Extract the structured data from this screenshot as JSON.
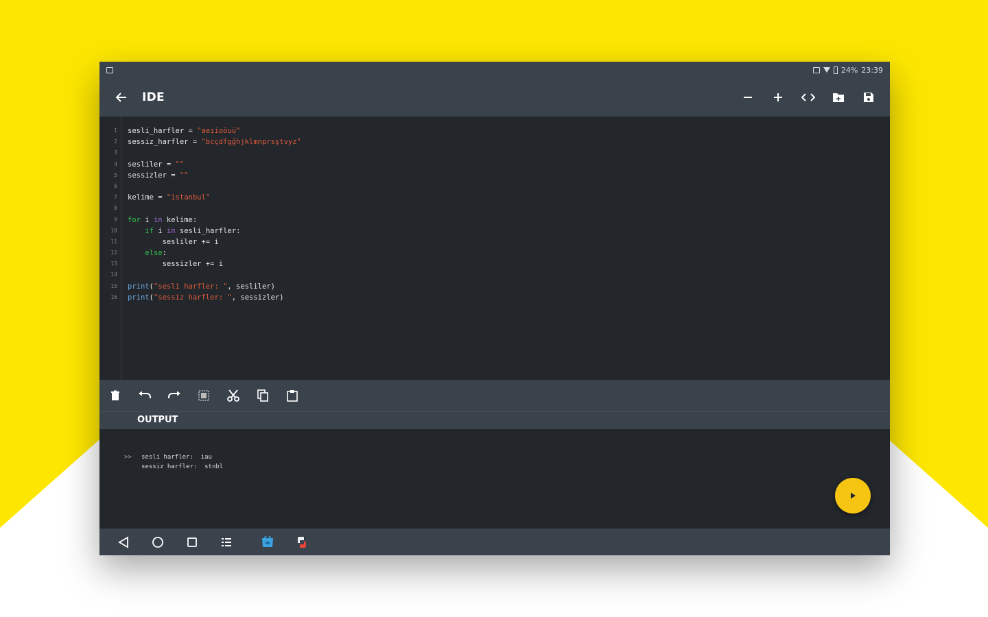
{
  "colors": {
    "background_yellow": "#fde700",
    "background_white": "#ffffff",
    "appbar": "#3a424c",
    "editor_bg": "#23272c",
    "fab": "#f5c511",
    "keyword": "#33c24a",
    "string": "#e05a3a",
    "operator": "#a56bd8",
    "builtin": "#6aa6e0"
  },
  "statusbar": {
    "battery": "24%",
    "time": "23:39"
  },
  "appbar": {
    "title": "IDE",
    "back_icon": "arrow-left-icon",
    "actions": [
      "minus-icon",
      "plus-icon",
      "code-icon",
      "folder-icon",
      "save-icon"
    ]
  },
  "editor": {
    "line_numbers": [
      "1",
      "2",
      "3",
      "4",
      "5",
      "6",
      "7",
      "8",
      "9",
      "10",
      "11",
      "12",
      "13",
      "14",
      "15",
      "16"
    ],
    "lines": [
      {
        "parts": [
          {
            "t": "sesli_harfler = ",
            "c": ""
          },
          {
            "t": "\"aeıioöuü\"",
            "c": "s"
          }
        ]
      },
      {
        "parts": [
          {
            "t": "sessiz_harfler = ",
            "c": ""
          },
          {
            "t": "\"bcçdfgğhjklmnprsştvyz\"",
            "c": "s"
          }
        ]
      },
      {
        "parts": [
          {
            "t": "",
            "c": ""
          }
        ]
      },
      {
        "parts": [
          {
            "t": "sesliler = ",
            "c": ""
          },
          {
            "t": "\"\"",
            "c": "s"
          }
        ]
      },
      {
        "parts": [
          {
            "t": "sessizler = ",
            "c": ""
          },
          {
            "t": "\"\"",
            "c": "s"
          }
        ]
      },
      {
        "parts": [
          {
            "t": "",
            "c": ""
          }
        ]
      },
      {
        "parts": [
          {
            "t": "kelime = ",
            "c": ""
          },
          {
            "t": "\"istanbul\"",
            "c": "s"
          }
        ]
      },
      {
        "parts": [
          {
            "t": "",
            "c": ""
          }
        ]
      },
      {
        "parts": [
          {
            "t": "for",
            "c": "k"
          },
          {
            "t": " i ",
            "c": ""
          },
          {
            "t": "in",
            "c": "o"
          },
          {
            "t": " kelime:",
            "c": ""
          }
        ]
      },
      {
        "parts": [
          {
            "t": "    ",
            "c": ""
          },
          {
            "t": "if",
            "c": "k"
          },
          {
            "t": " i ",
            "c": ""
          },
          {
            "t": "in",
            "c": "o"
          },
          {
            "t": " sesli_harfler:",
            "c": ""
          }
        ]
      },
      {
        "parts": [
          {
            "t": "        sesliler += i",
            "c": ""
          }
        ]
      },
      {
        "parts": [
          {
            "t": "    ",
            "c": ""
          },
          {
            "t": "else",
            "c": "k"
          },
          {
            "t": ":",
            "c": ""
          }
        ]
      },
      {
        "parts": [
          {
            "t": "        sessizler += i",
            "c": ""
          }
        ]
      },
      {
        "parts": [
          {
            "t": "",
            "c": ""
          }
        ]
      },
      {
        "parts": [
          {
            "t": "print",
            "c": "f"
          },
          {
            "t": "(",
            "c": ""
          },
          {
            "t": "\"sesli harfler: \"",
            "c": "s"
          },
          {
            "t": ", sesliler)",
            "c": ""
          }
        ]
      },
      {
        "parts": [
          {
            "t": "print",
            "c": "f"
          },
          {
            "t": "(",
            "c": ""
          },
          {
            "t": "\"sessiz harfler: \"",
            "c": "s"
          },
          {
            "t": ", sessizler)",
            "c": ""
          }
        ]
      }
    ]
  },
  "toolbar": {
    "icons": [
      "delete-icon",
      "undo-icon",
      "redo-icon",
      "select-all-icon",
      "cut-icon",
      "copy-icon",
      "paste-icon"
    ]
  },
  "output": {
    "label": "OUTPUT",
    "prompt": ">>",
    "lines": [
      "sesli harfler:  iau",
      "sessiz harfler:  stnbl"
    ]
  },
  "fab": {
    "icon": "play-icon"
  },
  "navbar": {
    "icons": [
      "back-triangle-icon",
      "home-circle-icon",
      "recents-square-icon",
      "app-drawer-icon",
      "store-app-icon",
      "python-app-icon"
    ]
  }
}
